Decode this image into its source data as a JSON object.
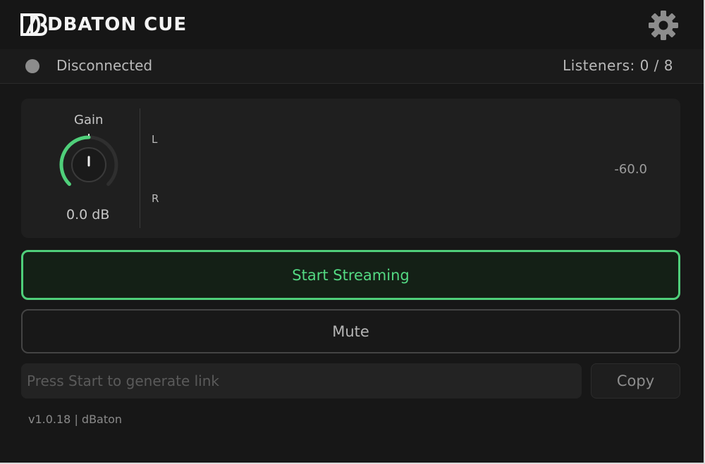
{
  "app": {
    "logo_text": "DBATON CUE",
    "settings_icon": "gear-icon"
  },
  "status": {
    "text": "Disconnected",
    "dot_color": "#8c8c8c",
    "listeners": "Listeners: 0 / 8"
  },
  "meter": {
    "gain_label": "Gain",
    "gain_value": "0.0 dB",
    "channel_left": "L",
    "channel_right": "R",
    "level_readout": "-60.0"
  },
  "actions": {
    "start_label": "Start Streaming",
    "mute_label": "Mute",
    "link_placeholder": "Press Start to generate link",
    "link_value": "",
    "copy_label": "Copy"
  },
  "footer": {
    "text": "v1.0.18 | dBaton"
  },
  "colors": {
    "accent": "#4fcf7a",
    "background": "#171717"
  }
}
